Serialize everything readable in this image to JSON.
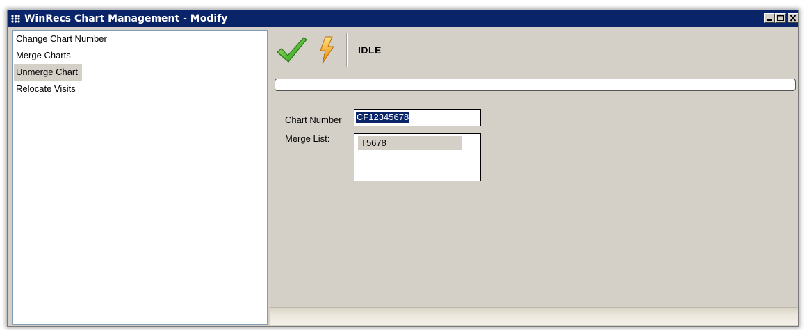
{
  "window": {
    "title": "WinRecs Chart Management - Modify"
  },
  "nav": {
    "items": [
      {
        "label": "Change Chart Number",
        "selected": false
      },
      {
        "label": "Merge Charts",
        "selected": false
      },
      {
        "label": "Unmerge Chart",
        "selected": true
      },
      {
        "label": "Relocate Visits",
        "selected": false
      }
    ]
  },
  "toolbar": {
    "status": "IDLE",
    "icons": [
      "checkmark-icon",
      "lightning-bolt-icon"
    ]
  },
  "progress": {
    "value": 0
  },
  "form": {
    "chart_number_label": "Chart Number",
    "chart_number_value": "CF12345678",
    "merge_list_label": "Merge List:",
    "merge_list_items": [
      "T5678"
    ]
  },
  "colors": {
    "titlebar": "#0a246a",
    "window_bg": "#d4d0c8",
    "selection": "#0a246a",
    "check_green": "#3aa52a",
    "bolt_orange": "#f5a623"
  }
}
